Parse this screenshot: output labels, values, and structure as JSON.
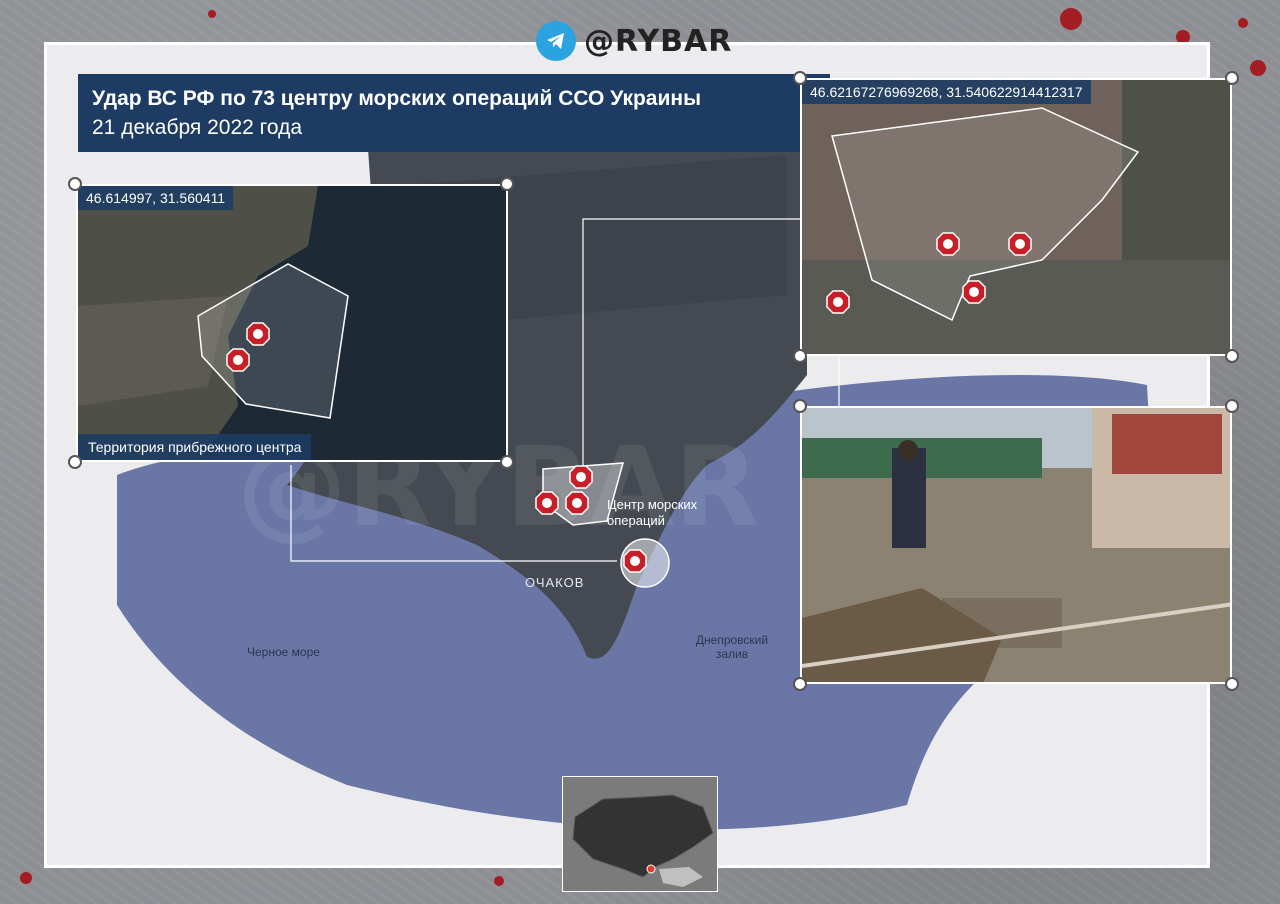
{
  "brand": {
    "handle": "@RYBAR",
    "icon": "telegram-icon"
  },
  "title": {
    "line1": "Удар ВС РФ по 73 центру морских операций ССО Украины",
    "line2": "21 декабря 2022 года"
  },
  "insets": {
    "coastal": {
      "coordinates": "46.614997, 31.560411",
      "caption": "Территория прибрежного центра"
    },
    "airfield": {
      "coordinates": "46.62167276969268, 31.540622914412317"
    }
  },
  "map_labels": {
    "center_label": "Центр морских\nопераций",
    "city": "ОЧАКОВ",
    "black_sea": "Черное море",
    "dnieper_bay": "Днепровский\nзалив"
  },
  "colors": {
    "title_bg": "#1d3b63",
    "sea": "#6a77a6",
    "land": "#454a52",
    "strike": "#c81e28",
    "accent_blood": "#a31d22"
  }
}
